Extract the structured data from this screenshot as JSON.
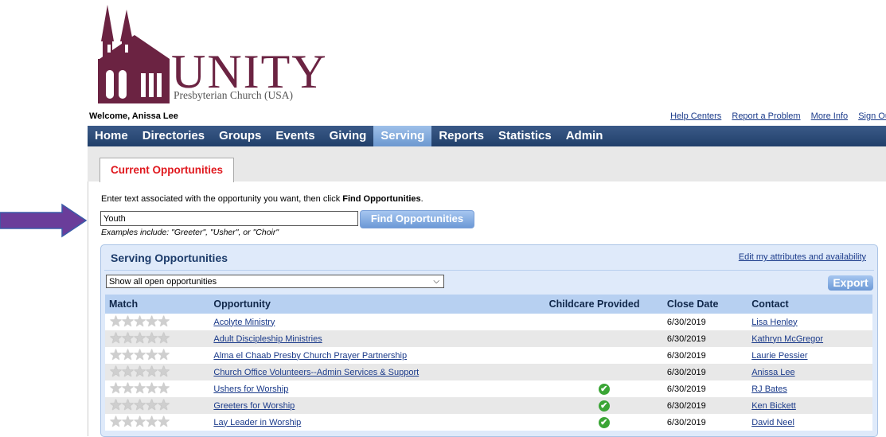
{
  "brand": {
    "name": "UNITY",
    "subtitle": "Presbyterian Church (USA)",
    "color": "#6b2342"
  },
  "header": {
    "welcome": "Welcome, Anissa Lee",
    "links": [
      "Help Centers",
      "Report a Problem",
      "More Info",
      "Sign Out"
    ]
  },
  "nav": {
    "items": [
      "Home",
      "Directories",
      "Groups",
      "Events",
      "Giving",
      "Serving",
      "Reports",
      "Statistics",
      "Admin"
    ],
    "active": "Serving"
  },
  "tab": {
    "label": "Current Opportunities"
  },
  "search": {
    "instruction_prefix": "Enter text associated with the opportunity you want, then click ",
    "instruction_bold": "Find Opportunities",
    "instruction_suffix": ".",
    "value": "Youth",
    "button": "Find Opportunities",
    "examples": "Examples include: \"Greeter\", \"Usher\", or \"Choir\""
  },
  "panel": {
    "title": "Serving Opportunities",
    "link": "Edit my attributes and availability",
    "filter": "Show all open opportunities",
    "export": "Export"
  },
  "table": {
    "headers": [
      "Match",
      "Opportunity",
      "Childcare Provided",
      "Close Date",
      "Contact"
    ],
    "rows": [
      {
        "stars": "★★★★★",
        "opportunity": "Acolyte Ministry",
        "childcare": "",
        "close": "6/30/2019",
        "contact": "Lisa Henley"
      },
      {
        "stars": "★★★★★",
        "opportunity": "Adult Discipleship Ministries",
        "childcare": "",
        "close": "6/30/2019",
        "contact": "Kathryn McGregor"
      },
      {
        "stars": "★★★★★",
        "opportunity": "Alma el Chaab Presby Church Prayer Partnership",
        "childcare": "",
        "close": "6/30/2019",
        "contact": "Laurie Pessier"
      },
      {
        "stars": "★★★★★",
        "opportunity": "Church Office Volunteers--Admin Services & Support",
        "childcare": "",
        "close": "6/30/2019",
        "contact": "Anissa Lee"
      },
      {
        "stars": "★★★★★",
        "opportunity": "Ushers for Worship",
        "childcare": "✔",
        "close": "6/30/2019",
        "contact": "RJ Bates"
      },
      {
        "stars": "★★★★★",
        "opportunity": "Greeters for Worship",
        "childcare": "✔",
        "close": "6/30/2019",
        "contact": "Ken Bickett"
      },
      {
        "stars": "★★★★★",
        "opportunity": "Lay Leader in Worship",
        "childcare": "✔",
        "close": "6/30/2019",
        "contact": "David Neel"
      }
    ]
  },
  "annotation": {
    "arrow_color": "#6a3d9a"
  }
}
